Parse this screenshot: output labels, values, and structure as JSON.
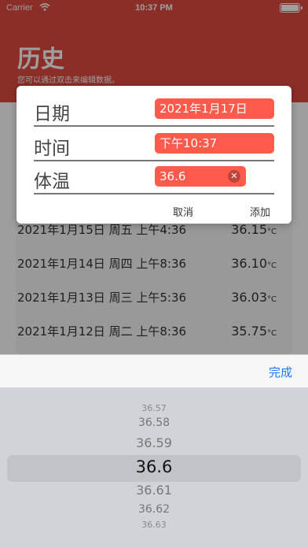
{
  "status_bar": {
    "carrier": "Carrier",
    "time": "10:37 PM"
  },
  "header": {
    "title": "历史",
    "subtitle": "您可以通过双击来编辑数据。"
  },
  "history": [
    {
      "when": "2021年1月15日 周五 上午4:36",
      "temp": "36.15",
      "unit": "°C"
    },
    {
      "when": "2021年1月14日 周四 上午8:36",
      "temp": "36.10",
      "unit": "°C"
    },
    {
      "when": "2021年1月13日 周三 上午5:36",
      "temp": "36.03",
      "unit": "°C"
    },
    {
      "when": "2021年1月12日 周二 上午8:36",
      "temp": "35.75",
      "unit": "°C"
    }
  ],
  "dialog": {
    "date_label": "日期",
    "date_value": "2021年1月17日",
    "time_label": "时间",
    "time_value": "下午10:37",
    "temp_label": "体温",
    "temp_value": "36.6",
    "cancel": "取消",
    "add": "添加"
  },
  "picker": {
    "done": "完成",
    "options": [
      "36.57",
      "36.58",
      "36.59",
      "36.6",
      "36.61",
      "36.62",
      "36.63"
    ],
    "selected": "36.6"
  },
  "colors": {
    "header": "#e14b40",
    "field": "#ff5a4b",
    "done": "#1d7bff"
  }
}
